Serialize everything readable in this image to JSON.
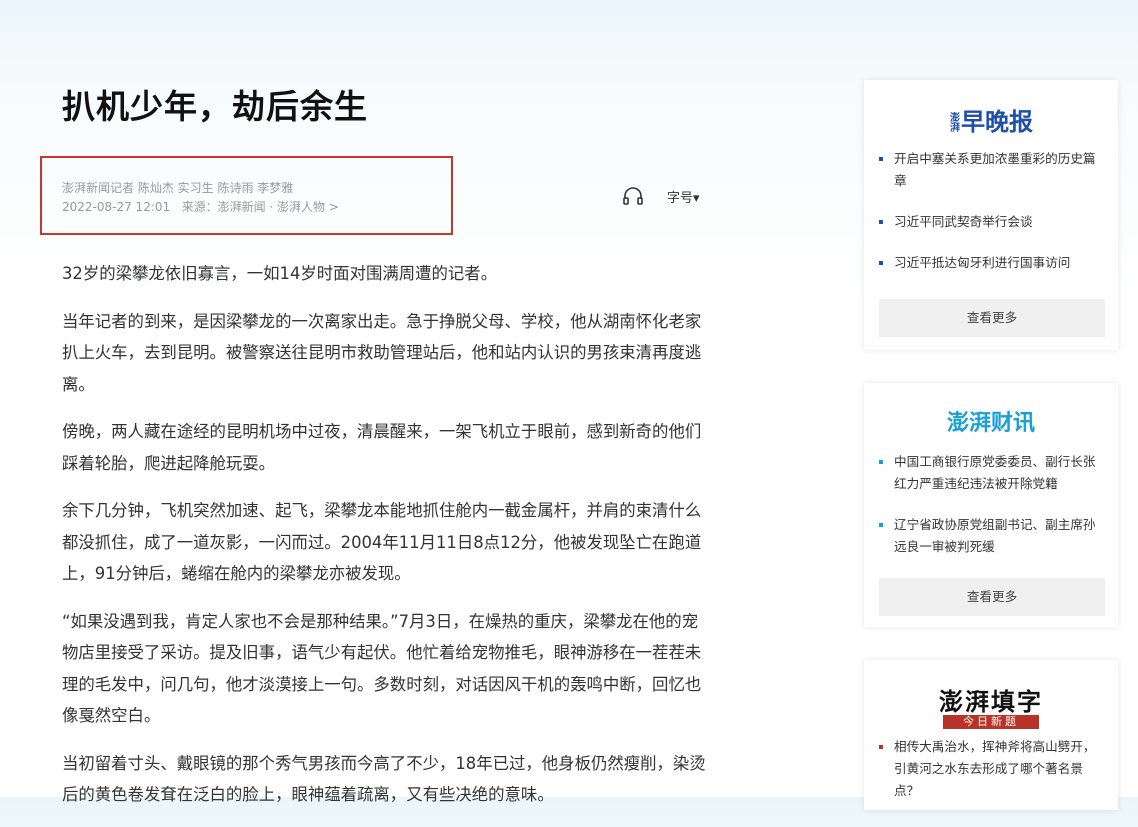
{
  "article": {
    "title": "扒机少年，劫后余生",
    "meta_line1": "澎湃新闻记者 陈灿杰 实习生 陈诗雨 李梦雅",
    "meta_date": "2022-08-27 12:01",
    "meta_source": "来源：澎湃新闻 · 澎湃人物 >",
    "font_size_label": "字号▾",
    "paragraphs": [
      "32岁的梁攀龙依旧寡言，一如14岁时面对围满周遭的记者。",
      "当年记者的到来，是因梁攀龙的一次离家出走。急于挣脱父母、学校，他从湖南怀化老家扒上火车，去到昆明。被警察送往昆明市救助管理站后，他和站内认识的男孩束清再度逃离。",
      "傍晚，两人藏在途经的昆明机场中过夜，清晨醒来，一架飞机立于眼前，感到新奇的他们踩着轮胎，爬进起降舱玩耍。",
      "余下几分钟，飞机突然加速、起飞，梁攀龙本能地抓住舱内一截金属杆，并肩的束清什么都没抓住，成了一道灰影，一闪而过。2004年11月11日8点12分，他被发现坠亡在跑道上，91分钟后，蜷缩在舱内的梁攀龙亦被发现。",
      "“如果没遇到我，肯定人家也不会是那种结果。”7月3日，在燥热的重庆，梁攀龙在他的宠物店里接受了采访。提及旧事，语气少有起伏。他忙着给宠物推毛，眼神游移在一茬茬未理的毛发中，问几句，他才淡漠接上一句。多数时刻，对话因风干机的轰鸣中断，回忆也像戛然空白。",
      "当初留着寸头、戴眼镜的那个秀气男孩而今高了不少，18年已过，他身板仍然瘦削，染烫后的黄色卷发耷在泛白的脸上，眼神蕴着疏离，又有些决绝的意味。"
    ]
  },
  "sidebar": {
    "card1": {
      "logo_small": "澎湃",
      "logo_text": "早晚报",
      "items": [
        "开启中塞关系更加浓墨重彩的历史篇章",
        "习近平同武契奇举行会谈",
        "习近平抵达匈牙利进行国事访问"
      ],
      "more": "查看更多"
    },
    "card2": {
      "logo_text": "澎湃财讯",
      "items": [
        "中国工商银行原党委委员、副行长张红力严重违纪违法被开除党籍",
        "辽宁省政协原党组副书记、副主席孙远良一审被判死缓"
      ],
      "more": "查看更多"
    },
    "card3": {
      "logo_text": "澎湃填字",
      "logo_sub": "今日新题",
      "items": [
        "相传大禹治水，挥神斧将高山劈开，引黄河之水东去形成了哪个著名景点？"
      ]
    }
  },
  "colors": {
    "accent_red": "#c9362b",
    "brand_blue": "#1f4fa8",
    "caixun_blue": "#1aa0d6"
  }
}
